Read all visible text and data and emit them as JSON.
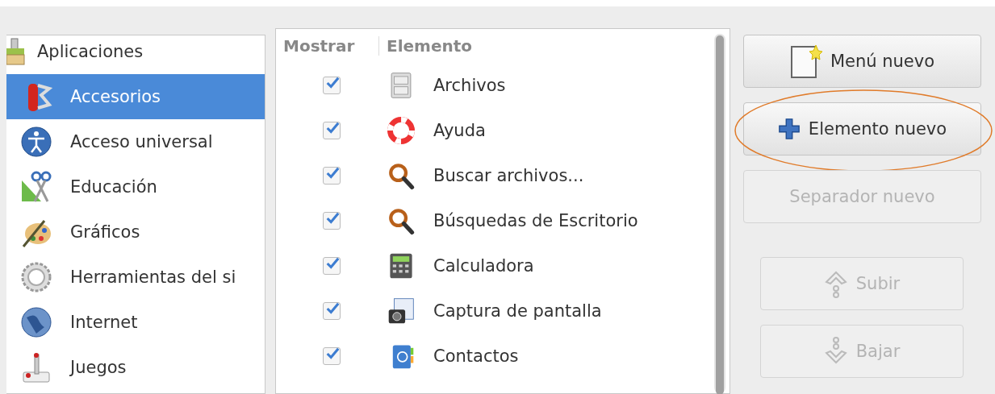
{
  "menus": {
    "items": [
      {
        "label": "Aplicaciones",
        "selected": false,
        "children": [
          {
            "label": "Accesorios",
            "selected": true
          },
          {
            "label": "Acceso universal",
            "selected": false
          },
          {
            "label": "Educación",
            "selected": false
          },
          {
            "label": "Gráficos",
            "selected": false
          },
          {
            "label": "Herramientas del si",
            "selected": false
          },
          {
            "label": "Internet",
            "selected": false
          },
          {
            "label": "Juegos",
            "selected": false
          }
        ]
      }
    ]
  },
  "items_table": {
    "columns": [
      "Mostrar",
      "Elemento"
    ],
    "rows": [
      {
        "shown": true,
        "name": "Archivos"
      },
      {
        "shown": true,
        "name": "Ayuda"
      },
      {
        "shown": true,
        "name": "Buscar archivos..."
      },
      {
        "shown": true,
        "name": "Búsquedas de Escritorio"
      },
      {
        "shown": true,
        "name": "Calculadora"
      },
      {
        "shown": true,
        "name": "Captura de pantalla"
      },
      {
        "shown": true,
        "name": "Contactos"
      }
    ]
  },
  "buttons": [
    {
      "label": "Menú nuevo",
      "disabled": false,
      "circled": false
    },
    {
      "label": "Elemento nuevo",
      "disabled": false,
      "circled": true
    },
    {
      "label": "Separador nuevo",
      "disabled": true,
      "circled": false
    }
  ],
  "move_buttons": [
    {
      "label": "Subir",
      "disabled": true
    },
    {
      "label": "Bajar",
      "disabled": true
    }
  ]
}
